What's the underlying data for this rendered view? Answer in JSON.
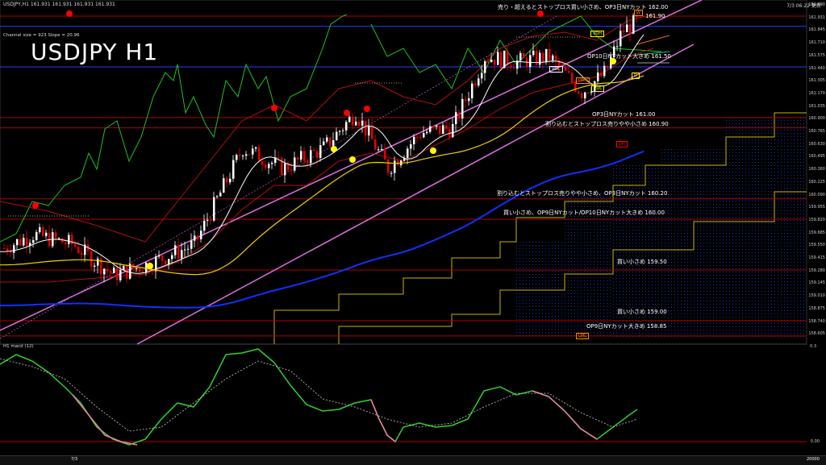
{
  "window": {
    "header": "USDJPY,H1  161.931 161.931 161.931 161.931",
    "channel_info": "Channel size = 923 Slope = 20.96",
    "title": "USDJPY H1",
    "timestamp": "7/3 06:22 更新",
    "macd_label": "H1  macd (12)"
  },
  "levels": [
    {
      "label": "売り・超えるとストップロス買い小さめ、OP3日NYカット 162.00",
      "price": 162.0
    },
    {
      "label": "161.90",
      "price": 161.9
    },
    {
      "label": "OP10日NYカット大きめ 161.50",
      "price": 161.5
    },
    {
      "label": "OP3日NYカット 161.00",
      "price": 161.0
    },
    {
      "label": "割り込むとストップロス売りやや小さめ 160.90",
      "price": 160.9
    },
    {
      "label": "割り込むとストップロス売りやや小さめ、OP3日NYカット 160.20",
      "price": 160.2
    },
    {
      "label": "買い小さめ、OP9日NYカット/OP10日NYカット大きめ 160.00",
      "price": 160.0
    },
    {
      "label": "買い小さめ 159.50",
      "price": 159.5
    },
    {
      "label": "買い小さめ 159.00",
      "price": 159.0
    },
    {
      "label": "OP9日NYカット大きめ 158.85",
      "price": 158.85
    }
  ],
  "price_axis": [
    "161.990",
    "161.931",
    "161.845",
    "161.710",
    "161.575",
    "161.440",
    "161.305",
    "161.170",
    "161.035",
    "160.900",
    "160.765",
    "160.630",
    "160.495",
    "160.360",
    "160.225",
    "160.090",
    "159.955",
    "159.820",
    "159.685",
    "159.550",
    "159.415",
    "159.280",
    "159.145",
    "159.010",
    "158.875",
    "158.740",
    "158.605"
  ],
  "macd_axis": {
    "top": "0.3",
    "zero": "0.00"
  },
  "tags": {
    "vdh": "VDH",
    "vdc": "VDC",
    "vdl": "VDL",
    "lwh": "LWH",
    "lwl": "LWL",
    "dh": "DH",
    "d": "D",
    "w": "W"
  },
  "bottom_bar": {
    "date": "7/3",
    "right": "20000"
  },
  "colors": {
    "bull": "#ffffff",
    "bear": "#e60000",
    "ma_fast": "#ffffff",
    "ma_mid": "#f0d000",
    "ma_slow": "#1030ff",
    "channel": "#e070e0",
    "levels": "#b00000",
    "macd": "#30d030",
    "macd_bear": "#f080a0"
  }
}
